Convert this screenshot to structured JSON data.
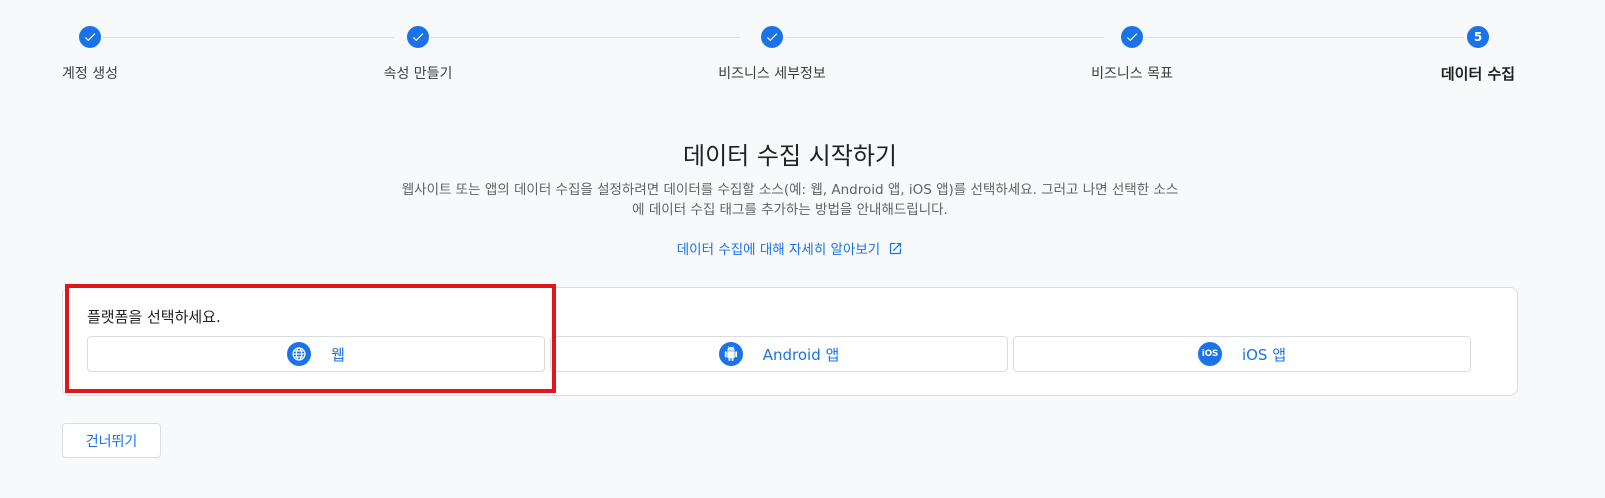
{
  "stepper": {
    "steps": [
      {
        "label": "계정 생성",
        "state": "complete"
      },
      {
        "label": "속성 만들기",
        "state": "complete"
      },
      {
        "label": "비즈니스 세부정보",
        "state": "complete"
      },
      {
        "label": "비즈니스 목표",
        "state": "complete"
      },
      {
        "label": "데이터 수집",
        "state": "active",
        "number": "5"
      }
    ]
  },
  "header": {
    "title": "데이터 수집 시작하기",
    "description_line1": "웹사이트 또는 앱의 데이터 수집을 설정하려면 데이터를 수집할 소스(예: 웹, Android 앱, iOS 앱)를 선택하세요. 그러고 나면 선택한 소스",
    "description_line2": "에 데이터 수집 태그를 추가하는 방법을 안내해드립니다.",
    "learn_more": "데이터 수집에 대해 자세히 알아보기"
  },
  "platform_card": {
    "title": "플랫폼을 선택하세요.",
    "options": [
      {
        "label": "웹",
        "icon": "globe-icon"
      },
      {
        "label": "Android 앱",
        "icon": "android-icon"
      },
      {
        "label": "iOS 앱",
        "icon": "ios-icon",
        "icon_text": "iOS"
      }
    ]
  },
  "skip_label": "건너뛰기",
  "colors": {
    "accent": "#1a73e8",
    "highlight": "#e0161d"
  }
}
